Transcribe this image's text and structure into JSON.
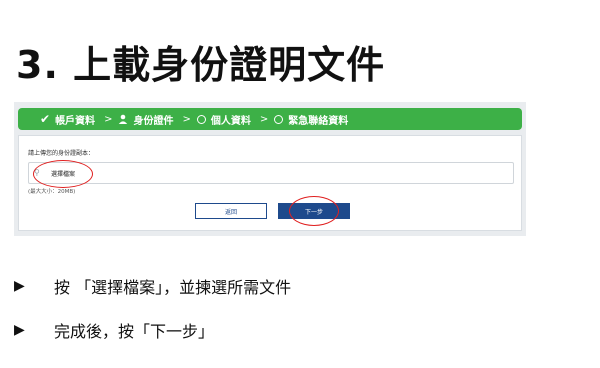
{
  "heading": "3. 上載身份證明文件",
  "steps": [
    {
      "label": "帳戶資料",
      "icon": "check-icon"
    },
    {
      "label": "身份證件",
      "icon": "user-icon"
    },
    {
      "label": "個人資料",
      "icon": "circle-icon"
    },
    {
      "label": "緊急聯絡資料",
      "icon": "circle-icon"
    }
  ],
  "step_separator": ">",
  "form": {
    "prompt": "請上傳您的身份證副本：",
    "file_button": "選擇檔案",
    "size_hint": "(最大大小：20MB)",
    "back_button": "返回",
    "next_button": "下一步"
  },
  "instructions": [
    "按 「選擇檔案」，並揀選所需文件",
    "完成後，按「下一步」"
  ],
  "colors": {
    "stepbar": "#3db047",
    "primary": "#1e4a8c",
    "highlight": "#e02020"
  }
}
